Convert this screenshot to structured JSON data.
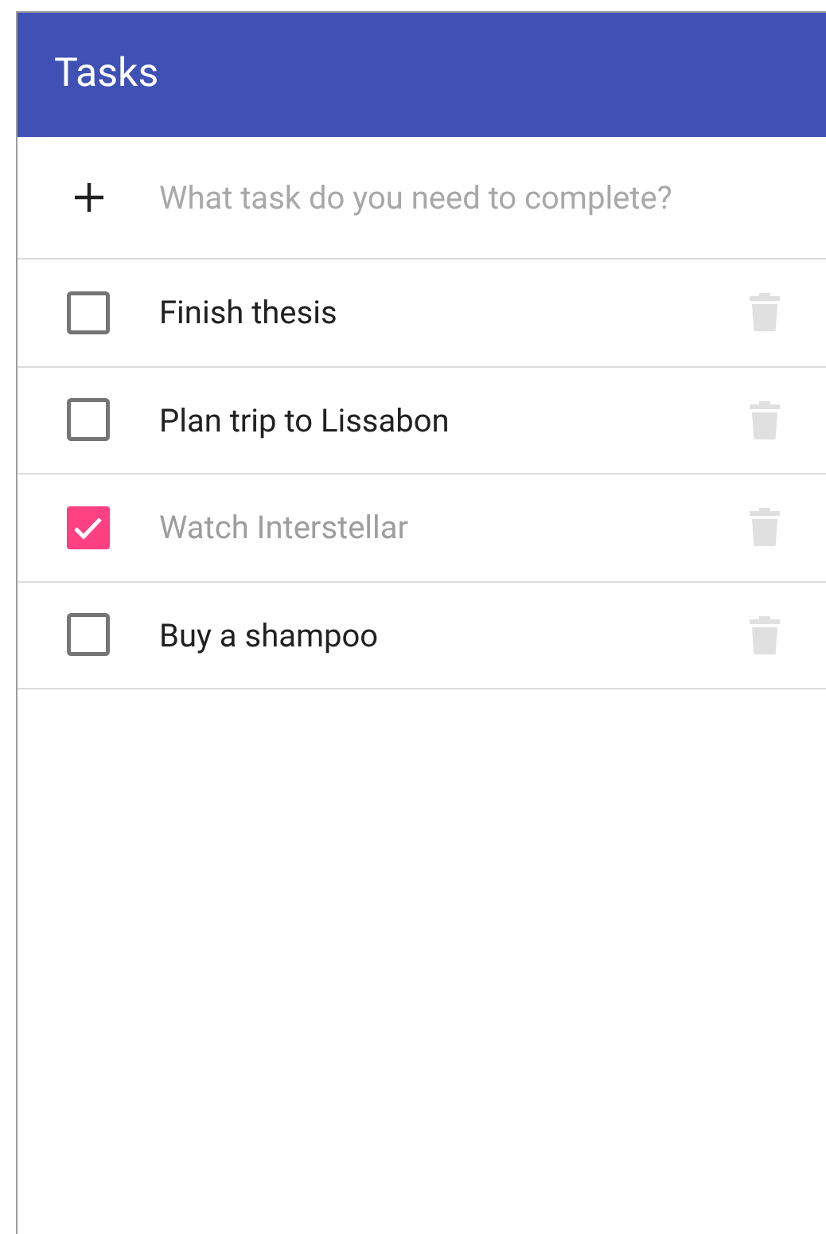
{
  "app_bar": {
    "title": "Tasks"
  },
  "new_task": {
    "placeholder": "What task do you need to complete?"
  },
  "tasks": [
    {
      "label": "Finish thesis",
      "checked": false
    },
    {
      "label": "Plan trip to Lissabon",
      "checked": false
    },
    {
      "label": "Watch Interstellar",
      "checked": true
    },
    {
      "label": "Buy a shampoo",
      "checked": false
    }
  ]
}
